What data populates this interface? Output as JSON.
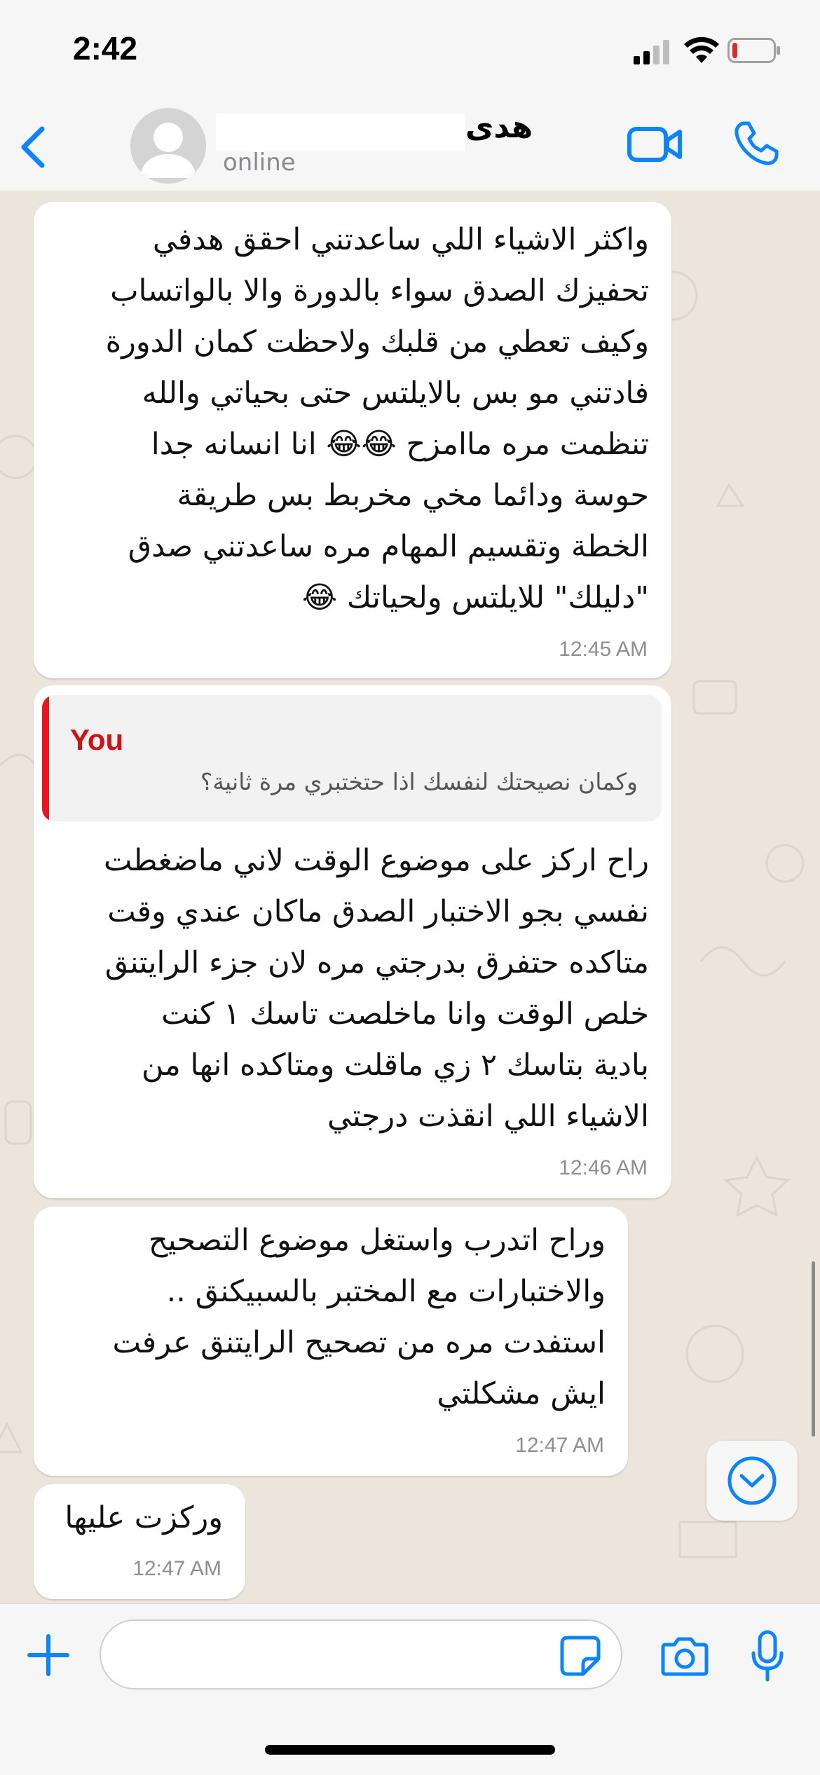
{
  "status_bar": {
    "time": "2:42",
    "battery_level": 0.12
  },
  "header": {
    "contact_name": "هدى",
    "presence": "online",
    "back_icon": "chevron-left-icon",
    "video_icon": "video-camera-icon",
    "phone_icon": "phone-icon",
    "accent_color": "#0a84ff"
  },
  "messages": [
    {
      "text": "واكثر الاشياء اللي ساعدتني احقق هدفي\nتحفيزك الصدق سواء بالدورة والا بالواتساب\nوكيف تعطي من قلبك ولاحظت كمان الدورة\nفادتني مو بس بالايلتس حتى بحياتي والله\nتنظمت مره ماامزح 😂😂 انا انسانه جدا\nحوسة ودائما مخي مخربط بس طريقة\nالخطة وتقسيم المهام مره ساعدتني صدق\n\"دليلك\" للايلتس ولحياتك 😂",
      "time": "12:45 AM"
    },
    {
      "reply_author": "You",
      "reply_text": "وكمان نصيحتك لنفسك اذا حتختبري مرة ثانية؟",
      "text": "راح اركز على موضوع الوقت لاني ماضغطت\nنفسي بجو الاختبار الصدق ماكان عندي وقت\nمتاكده حتفرق بدرجتي مره لان جزء الرايتنق\nخلص الوقت وانا ماخلصت تاسك ١ كنت\nبادية بتاسك ٢ زي ماقلت ومتاكده انها من\nالاشياء اللي انقذت درجتي",
      "time": "12:46 AM"
    },
    {
      "text": "وراح اتدرب واستغل موضوع التصحيح\nوالاختبارات مع المختبر بالسبيكنق ..\nاستفدت مره من تصحيح الرايتنق عرفت\nايش مشكلتي",
      "time": "12:47 AM"
    },
    {
      "text": "وركزت عليها",
      "time": "12:47 AM"
    }
  ],
  "input_bar": {
    "message_value": "",
    "plus_icon": "plus-icon",
    "sticker_icon": "sticker-icon",
    "camera_icon": "camera-icon",
    "mic_icon": "microphone-icon"
  }
}
